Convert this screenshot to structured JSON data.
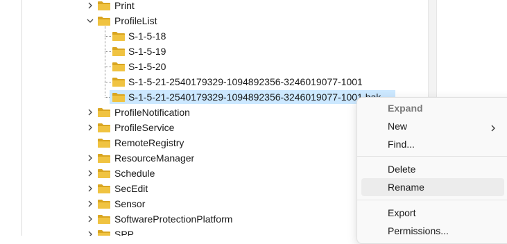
{
  "tree": {
    "items": [
      {
        "label": "Print",
        "expander": "collapsed"
      },
      {
        "label": "ProfileList",
        "expander": "expanded"
      },
      {
        "label": "S-1-5-18",
        "expander": "none"
      },
      {
        "label": "S-1-5-19",
        "expander": "none"
      },
      {
        "label": "S-1-5-20",
        "expander": "none"
      },
      {
        "label": "S-1-5-21-2540179329-1094892356-3246019077-1001",
        "expander": "none"
      },
      {
        "label": "S-1-5-21-2540179329-1094892356-3246019077-1001.bak",
        "expander": "none",
        "selected": true
      },
      {
        "label": "ProfileNotification",
        "expander": "collapsed"
      },
      {
        "label": "ProfileService",
        "expander": "collapsed"
      },
      {
        "label": "RemoteRegistry",
        "expander": "none"
      },
      {
        "label": "ResourceManager",
        "expander": "collapsed"
      },
      {
        "label": "Schedule",
        "expander": "collapsed"
      },
      {
        "label": "SecEdit",
        "expander": "collapsed"
      },
      {
        "label": "Sensor",
        "expander": "collapsed"
      },
      {
        "label": "SoftwareProtectionPlatform",
        "expander": "collapsed"
      },
      {
        "label": "SPP",
        "expander": "collapsed"
      }
    ]
  },
  "context_menu": {
    "items": [
      {
        "label": "Expand",
        "disabled": true
      },
      {
        "label": "New",
        "submenu": true
      },
      {
        "label": "Find..."
      },
      {
        "label": "Delete"
      },
      {
        "label": "Rename",
        "hover": true
      },
      {
        "label": "Export"
      },
      {
        "label": "Permissions..."
      }
    ]
  },
  "colors": {
    "folder": "#f0c341",
    "folder_dark": "#d9a520",
    "selection": "#cce8ff",
    "menu_bg": "#f9f9f9",
    "menu_hover": "#ececec"
  },
  "icons": {
    "folder": "folder-icon",
    "expand": "chevron-right-icon",
    "collapse": "chevron-down-icon",
    "submenu": "chevron-right-icon"
  }
}
